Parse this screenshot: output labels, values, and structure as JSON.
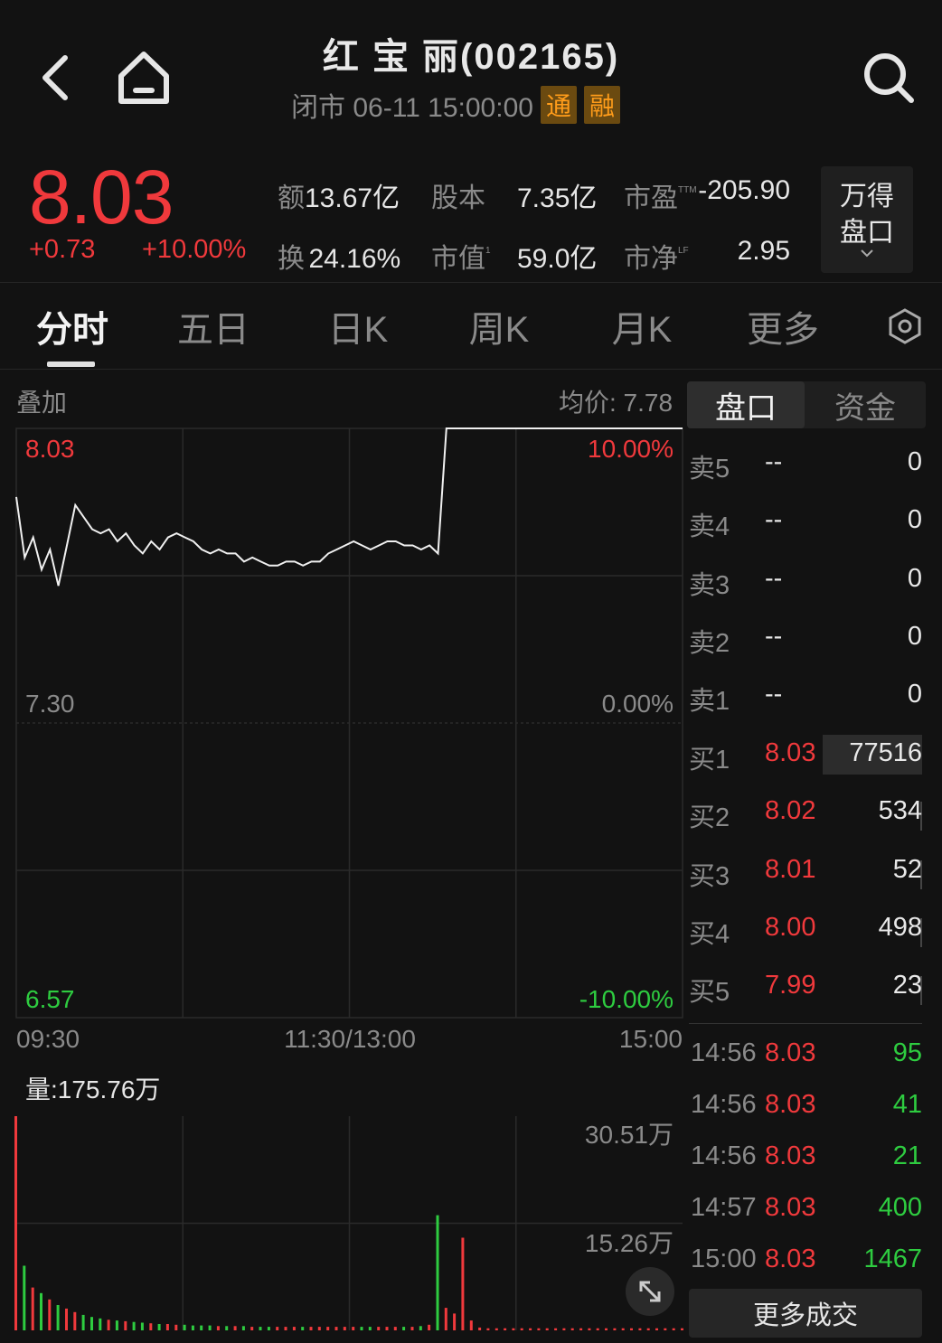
{
  "header": {
    "title": "红 宝 丽(002165)",
    "status": "闭市 06-11 15:00:00",
    "tag1": "通",
    "tag2": "融"
  },
  "quote": {
    "price": "8.03",
    "change": "+0.73",
    "change_pct": "+10.00%",
    "stats": [
      {
        "label": "额",
        "value": "13.67亿"
      },
      {
        "label": "股本",
        "value": "7.35亿"
      },
      {
        "label": "市盈",
        "sup": "TTM",
        "value": "-205.90"
      },
      {
        "label": "换",
        "value": "24.16%"
      },
      {
        "label": "市值",
        "sup": "1",
        "value": "59.0亿"
      },
      {
        "label": "市净",
        "sup": "LF",
        "value": "2.95"
      }
    ],
    "wind_button": [
      "万得",
      "盘口"
    ]
  },
  "tabs": [
    "分时",
    "五日",
    "日K",
    "周K",
    "月K",
    "更多"
  ],
  "chart": {
    "overlay_label": "叠加",
    "avg_price_label": "均价: 7.78",
    "price_high": "8.03",
    "price_mid": "7.30",
    "price_low": "6.57",
    "pct_high": "10.00%",
    "pct_mid": "0.00%",
    "pct_low": "-10.00%",
    "time_start": "09:30",
    "time_mid": "11:30/13:00",
    "time_end": "15:00",
    "volume_label": "量:175.76万",
    "vol_high": "30.51万",
    "vol_mid": "15.26万"
  },
  "chart_data": {
    "type": "line",
    "title": "",
    "xlabel": "",
    "ylabel": "",
    "ylim": [
      6.57,
      8.03
    ],
    "x_ticks": [
      "09:30",
      "11:30/13:00",
      "15:00"
    ],
    "price_series": [
      7.86,
      7.71,
      7.76,
      7.68,
      7.73,
      7.64,
      7.74,
      7.84,
      7.81,
      7.78,
      7.77,
      7.78,
      7.75,
      7.77,
      7.74,
      7.72,
      7.75,
      7.73,
      7.76,
      7.77,
      7.76,
      7.75,
      7.73,
      7.72,
      7.73,
      7.72,
      7.72,
      7.7,
      7.71,
      7.7,
      7.69,
      7.69,
      7.7,
      7.7,
      7.69,
      7.7,
      7.7,
      7.72,
      7.73,
      7.74,
      7.75,
      7.74,
      7.73,
      7.74,
      7.75,
      7.75,
      7.74,
      7.74,
      7.73,
      7.74,
      7.72,
      8.03,
      8.03,
      8.03,
      8.03,
      8.03,
      8.03,
      8.03,
      8.03,
      8.03,
      8.03,
      8.03,
      8.03,
      8.03,
      8.03,
      8.03,
      8.03,
      8.03,
      8.03,
      8.03,
      8.03,
      8.03,
      8.03,
      8.03,
      8.03,
      8.03,
      8.03,
      8.03,
      8.03,
      8.03
    ],
    "volume_series": [
      30.51,
      9.2,
      6.1,
      5.3,
      4.4,
      3.6,
      3.1,
      2.6,
      2.2,
      1.9,
      1.7,
      1.5,
      1.4,
      1.3,
      1.2,
      1.1,
      1.0,
      0.9,
      0.9,
      0.8,
      0.8,
      0.7,
      0.7,
      0.7,
      0.6,
      0.6,
      0.6,
      0.6,
      0.5,
      0.5,
      0.5,
      0.5,
      0.5,
      0.5,
      0.5,
      0.5,
      0.5,
      0.5,
      0.5,
      0.5,
      0.5,
      0.5,
      0.5,
      0.5,
      0.5,
      0.5,
      0.5,
      0.5,
      0.6,
      0.8,
      16.4,
      3.2,
      2.4,
      13.2,
      1.4,
      0.4,
      0.3,
      0.3,
      0.3,
      0.3,
      0.3,
      0.3,
      0.3,
      0.3,
      0.3,
      0.3,
      0.3,
      0.3,
      0.3,
      0.3,
      0.3,
      0.3,
      0.3,
      0.3,
      0.3,
      0.3,
      0.3,
      0.3,
      0.3,
      0.3
    ],
    "volume_ylim": [
      0,
      30.51
    ]
  },
  "order_panel": {
    "tab_active": "盘口",
    "tab_inactive": "资金",
    "asks": [
      {
        "label": "卖5",
        "price": "--",
        "vol": "0"
      },
      {
        "label": "卖4",
        "price": "--",
        "vol": "0"
      },
      {
        "label": "卖3",
        "price": "--",
        "vol": "0"
      },
      {
        "label": "卖2",
        "price": "--",
        "vol": "0"
      },
      {
        "label": "卖1",
        "price": "--",
        "vol": "0"
      }
    ],
    "bids": [
      {
        "label": "买1",
        "price": "8.03",
        "vol": "77516"
      },
      {
        "label": "买2",
        "price": "8.02",
        "vol": "534"
      },
      {
        "label": "买3",
        "price": "8.01",
        "vol": "52"
      },
      {
        "label": "买4",
        "price": "8.00",
        "vol": "498"
      },
      {
        "label": "买5",
        "price": "7.99",
        "vol": "23"
      }
    ],
    "trades": [
      {
        "time": "14:56",
        "price": "8.03",
        "vol": "95"
      },
      {
        "time": "14:56",
        "price": "8.03",
        "vol": "41"
      },
      {
        "time": "14:56",
        "price": "8.03",
        "vol": "21"
      },
      {
        "time": "14:57",
        "price": "8.03",
        "vol": "400"
      },
      {
        "time": "15:00",
        "price": "8.03",
        "vol": "1467"
      }
    ],
    "more_trades": "更多成交"
  },
  "colors": {
    "up": "#f0393c",
    "down": "#2ecc40",
    "line": "#f0f0f0",
    "grid": "#2a2a2a"
  }
}
